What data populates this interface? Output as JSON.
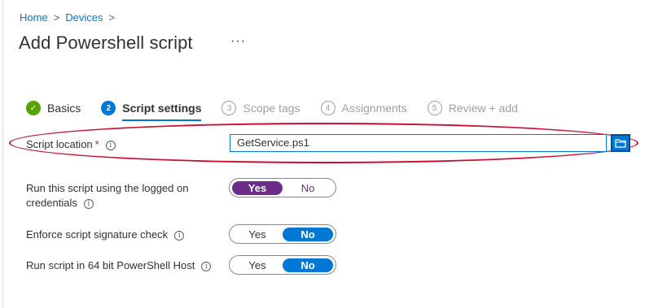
{
  "breadcrumb": {
    "home": "Home",
    "sep": ">",
    "devices": "Devices"
  },
  "page": {
    "title": "Add Powershell script",
    "more": "···"
  },
  "steps": [
    {
      "num": "✓",
      "label": "Basics"
    },
    {
      "num": "2",
      "label": "Script settings"
    },
    {
      "num": "3",
      "label": "Scope tags"
    },
    {
      "num": "4",
      "label": "Assignments"
    },
    {
      "num": "5",
      "label": "Review + add"
    }
  ],
  "script_location": {
    "label": "Script location",
    "required": "*",
    "value": "GetService.ps1"
  },
  "logged_on": {
    "label_line1": "Run this script using the logged on",
    "label_line2": "credentials",
    "yes": "Yes",
    "no": "No",
    "selected": "Yes"
  },
  "signature": {
    "label": "Enforce script signature check",
    "yes": "Yes",
    "no": "No",
    "selected": "No"
  },
  "host64": {
    "label": "Run script in 64 bit PowerShell Host",
    "yes": "Yes",
    "no": "No",
    "selected": "No"
  },
  "info_glyph": "i",
  "colors": {
    "accent": "#0078d4",
    "purple": "#6b2c8a",
    "highlight": "#c8102e",
    "success": "#57a300"
  }
}
